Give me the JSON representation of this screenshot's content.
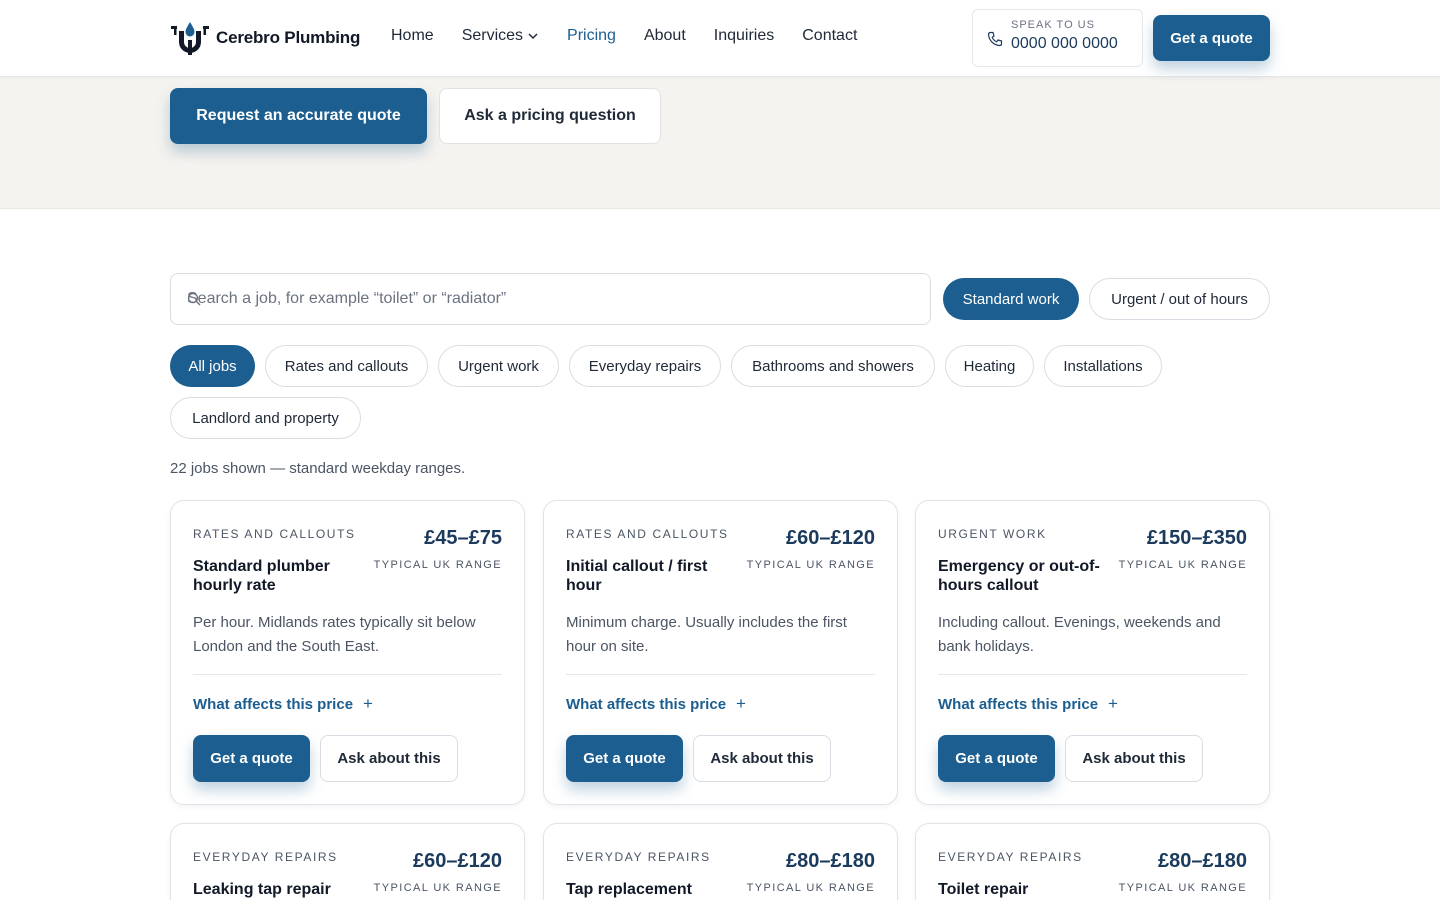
{
  "brand": {
    "name": "Cerebro Plumbing",
    "accent": "#1b5e8f",
    "navy": "#1b3a5c"
  },
  "nav": {
    "items": [
      {
        "label": "Home"
      },
      {
        "label": "Services",
        "has_menu": true
      },
      {
        "label": "Pricing",
        "active": true
      },
      {
        "label": "About"
      },
      {
        "label": "Inquiries"
      },
      {
        "label": "Contact"
      }
    ]
  },
  "header": {
    "phone_caption": "SPEAK TO US",
    "phone_number": "0000 000 0000",
    "quote_label": "Get a quote"
  },
  "hero": {
    "primary_label": "Request an accurate quote",
    "secondary_label": "Ask a pricing question"
  },
  "search": {
    "value": "",
    "placeholder": "Search a job, for example “toilet” or “radiator”"
  },
  "mode_toggle": {
    "standard": "Standard work",
    "urgent": "Urgent / out of hours",
    "selected": "standard"
  },
  "filters": [
    {
      "label": "All jobs",
      "active": true
    },
    {
      "label": "Rates and callouts"
    },
    {
      "label": "Urgent work"
    },
    {
      "label": "Everyday repairs"
    },
    {
      "label": "Bathrooms and showers"
    },
    {
      "label": "Heating"
    },
    {
      "label": "Installations"
    },
    {
      "label": "Landlord and property"
    }
  ],
  "results_summary": "22 jobs shown — standard weekday ranges.",
  "card_labels": {
    "range_caption": "TYPICAL UK RANGE",
    "affects": "What affects this price",
    "quote": "Get a quote",
    "ask": "Ask about this"
  },
  "cards": [
    {
      "category": "RATES AND CALLOUTS",
      "price": "£45–£75",
      "title": "Standard plumber hourly rate",
      "description": "Per hour. Midlands rates typically sit below London and the South East."
    },
    {
      "category": "RATES AND CALLOUTS",
      "price": "£60–£120",
      "title": "Initial callout / first hour",
      "description": "Minimum charge. Usually includes the first hour on site."
    },
    {
      "category": "URGENT WORK",
      "price": "£150–£350",
      "title": "Emergency or out-of-hours callout",
      "description": "Including callout. Evenings, weekends and bank holidays."
    },
    {
      "category": "EVERYDAY REPAIRS",
      "price": "£60–£120",
      "title": "Leaking tap repair",
      "description": ""
    },
    {
      "category": "EVERYDAY REPAIRS",
      "price": "£80–£180",
      "title": "Tap replacement",
      "description": ""
    },
    {
      "category": "EVERYDAY REPAIRS",
      "price": "£80–£180",
      "title": "Toilet repair",
      "description": ""
    }
  ]
}
